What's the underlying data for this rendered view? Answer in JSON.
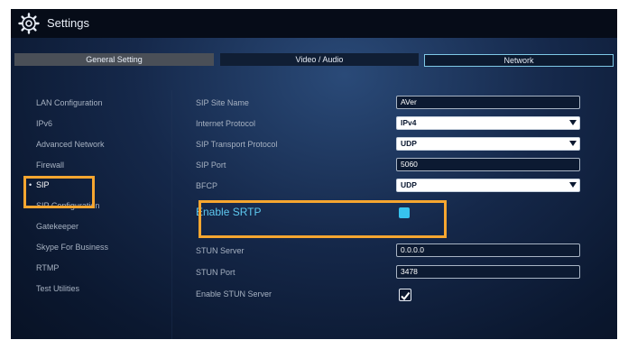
{
  "header": {
    "title": "Settings",
    "icon": "gear-icon"
  },
  "tabs": [
    {
      "label": "General Setting",
      "active": false
    },
    {
      "label": "Video / Audio",
      "active": false
    },
    {
      "label": "Network",
      "active": true
    }
  ],
  "sidebar": {
    "active_bullet": "•",
    "items": [
      {
        "label": "LAN Configuration"
      },
      {
        "label": "IPv6"
      },
      {
        "label": "Advanced Network"
      },
      {
        "label": "Firewall"
      },
      {
        "label": "SIP"
      },
      {
        "label": "SIP Configuration"
      },
      {
        "label": "Gatekeeper"
      },
      {
        "label": "Skype For Business"
      },
      {
        "label": "RTMP"
      },
      {
        "label": "Test Utilities"
      }
    ]
  },
  "form": {
    "sip_site_name": {
      "label": "SIP Site Name",
      "value": "AVer"
    },
    "internet_protocol": {
      "label": "Internet Protocol",
      "value": "IPv4"
    },
    "sip_transport_protocol": {
      "label": "SIP Transport Protocol",
      "value": "UDP"
    },
    "sip_port": {
      "label": "SIP Port",
      "value": "5060"
    },
    "bfcp": {
      "label": "BFCP",
      "value": "UDP"
    },
    "enable_srtp": {
      "label": "Enable SRTP",
      "checked": true
    },
    "stun_server": {
      "label": "STUN Server",
      "value": "0.0.0.0"
    },
    "stun_port": {
      "label": "STUN Port",
      "value": "3478"
    },
    "enable_stun_server": {
      "label": "Enable STUN Server",
      "checked": true
    }
  },
  "colors": {
    "highlight": "#f6a630",
    "accent": "#37c3ee",
    "background": "#15284a"
  }
}
